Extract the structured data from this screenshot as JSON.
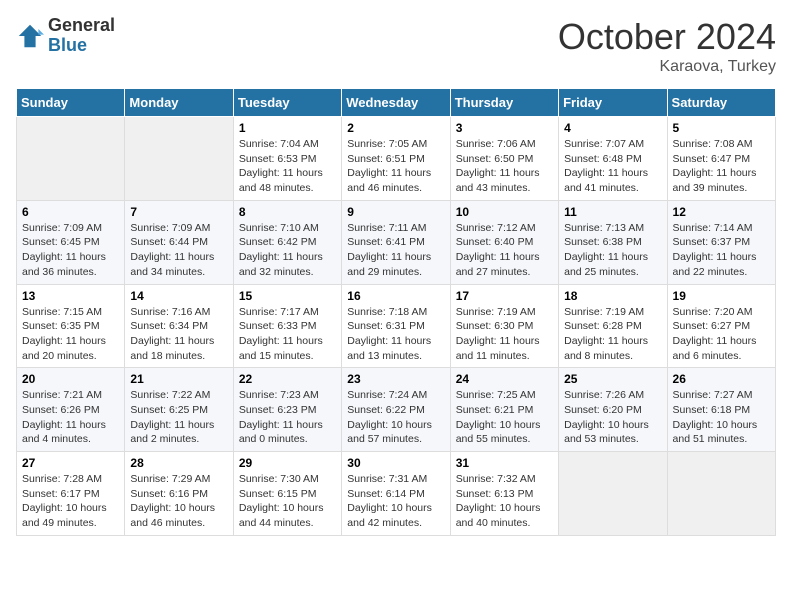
{
  "logo": {
    "general": "General",
    "blue": "Blue"
  },
  "title": "October 2024",
  "location": "Karaova, Turkey",
  "days_header": [
    "Sunday",
    "Monday",
    "Tuesday",
    "Wednesday",
    "Thursday",
    "Friday",
    "Saturday"
  ],
  "weeks": [
    [
      {
        "day": "",
        "info": ""
      },
      {
        "day": "",
        "info": ""
      },
      {
        "day": "1",
        "info": "Sunrise: 7:04 AM\nSunset: 6:53 PM\nDaylight: 11 hours and 48 minutes."
      },
      {
        "day": "2",
        "info": "Sunrise: 7:05 AM\nSunset: 6:51 PM\nDaylight: 11 hours and 46 minutes."
      },
      {
        "day": "3",
        "info": "Sunrise: 7:06 AM\nSunset: 6:50 PM\nDaylight: 11 hours and 43 minutes."
      },
      {
        "day": "4",
        "info": "Sunrise: 7:07 AM\nSunset: 6:48 PM\nDaylight: 11 hours and 41 minutes."
      },
      {
        "day": "5",
        "info": "Sunrise: 7:08 AM\nSunset: 6:47 PM\nDaylight: 11 hours and 39 minutes."
      }
    ],
    [
      {
        "day": "6",
        "info": "Sunrise: 7:09 AM\nSunset: 6:45 PM\nDaylight: 11 hours and 36 minutes."
      },
      {
        "day": "7",
        "info": "Sunrise: 7:09 AM\nSunset: 6:44 PM\nDaylight: 11 hours and 34 minutes."
      },
      {
        "day": "8",
        "info": "Sunrise: 7:10 AM\nSunset: 6:42 PM\nDaylight: 11 hours and 32 minutes."
      },
      {
        "day": "9",
        "info": "Sunrise: 7:11 AM\nSunset: 6:41 PM\nDaylight: 11 hours and 29 minutes."
      },
      {
        "day": "10",
        "info": "Sunrise: 7:12 AM\nSunset: 6:40 PM\nDaylight: 11 hours and 27 minutes."
      },
      {
        "day": "11",
        "info": "Sunrise: 7:13 AM\nSunset: 6:38 PM\nDaylight: 11 hours and 25 minutes."
      },
      {
        "day": "12",
        "info": "Sunrise: 7:14 AM\nSunset: 6:37 PM\nDaylight: 11 hours and 22 minutes."
      }
    ],
    [
      {
        "day": "13",
        "info": "Sunrise: 7:15 AM\nSunset: 6:35 PM\nDaylight: 11 hours and 20 minutes."
      },
      {
        "day": "14",
        "info": "Sunrise: 7:16 AM\nSunset: 6:34 PM\nDaylight: 11 hours and 18 minutes."
      },
      {
        "day": "15",
        "info": "Sunrise: 7:17 AM\nSunset: 6:33 PM\nDaylight: 11 hours and 15 minutes."
      },
      {
        "day": "16",
        "info": "Sunrise: 7:18 AM\nSunset: 6:31 PM\nDaylight: 11 hours and 13 minutes."
      },
      {
        "day": "17",
        "info": "Sunrise: 7:19 AM\nSunset: 6:30 PM\nDaylight: 11 hours and 11 minutes."
      },
      {
        "day": "18",
        "info": "Sunrise: 7:19 AM\nSunset: 6:28 PM\nDaylight: 11 hours and 8 minutes."
      },
      {
        "day": "19",
        "info": "Sunrise: 7:20 AM\nSunset: 6:27 PM\nDaylight: 11 hours and 6 minutes."
      }
    ],
    [
      {
        "day": "20",
        "info": "Sunrise: 7:21 AM\nSunset: 6:26 PM\nDaylight: 11 hours and 4 minutes."
      },
      {
        "day": "21",
        "info": "Sunrise: 7:22 AM\nSunset: 6:25 PM\nDaylight: 11 hours and 2 minutes."
      },
      {
        "day": "22",
        "info": "Sunrise: 7:23 AM\nSunset: 6:23 PM\nDaylight: 11 hours and 0 minutes."
      },
      {
        "day": "23",
        "info": "Sunrise: 7:24 AM\nSunset: 6:22 PM\nDaylight: 10 hours and 57 minutes."
      },
      {
        "day": "24",
        "info": "Sunrise: 7:25 AM\nSunset: 6:21 PM\nDaylight: 10 hours and 55 minutes."
      },
      {
        "day": "25",
        "info": "Sunrise: 7:26 AM\nSunset: 6:20 PM\nDaylight: 10 hours and 53 minutes."
      },
      {
        "day": "26",
        "info": "Sunrise: 7:27 AM\nSunset: 6:18 PM\nDaylight: 10 hours and 51 minutes."
      }
    ],
    [
      {
        "day": "27",
        "info": "Sunrise: 7:28 AM\nSunset: 6:17 PM\nDaylight: 10 hours and 49 minutes."
      },
      {
        "day": "28",
        "info": "Sunrise: 7:29 AM\nSunset: 6:16 PM\nDaylight: 10 hours and 46 minutes."
      },
      {
        "day": "29",
        "info": "Sunrise: 7:30 AM\nSunset: 6:15 PM\nDaylight: 10 hours and 44 minutes."
      },
      {
        "day": "30",
        "info": "Sunrise: 7:31 AM\nSunset: 6:14 PM\nDaylight: 10 hours and 42 minutes."
      },
      {
        "day": "31",
        "info": "Sunrise: 7:32 AM\nSunset: 6:13 PM\nDaylight: 10 hours and 40 minutes."
      },
      {
        "day": "",
        "info": ""
      },
      {
        "day": "",
        "info": ""
      }
    ]
  ]
}
